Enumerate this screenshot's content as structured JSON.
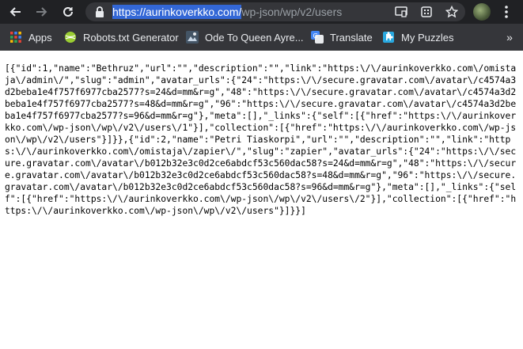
{
  "browser": {
    "url_host": "https://aurinkoverkko.com/",
    "url_path": "wp-json/wp/v2/users",
    "icons": {
      "back": "back-arrow-icon",
      "forward": "forward-arrow-icon",
      "reload": "reload-icon",
      "lock": "lock-icon",
      "cast": "cast-icon",
      "extensions": "extensions-icon",
      "bookmark": "star-icon",
      "menu": "kebab-menu-icon"
    }
  },
  "bookmarks": {
    "items": [
      {
        "label": "Apps",
        "icon": "apps-grid-icon"
      },
      {
        "label": "Robots.txt Generator",
        "icon": "robots-ball-icon"
      },
      {
        "label": "Ode To Queen Ayre...",
        "icon": "ode-image-icon"
      },
      {
        "label": "Translate",
        "icon": "google-translate-icon"
      },
      {
        "label": "My Puzzles",
        "icon": "puzzle-icon"
      }
    ],
    "more": "»"
  },
  "page": {
    "json_text": "[{\"id\":1,\"name\":\"Bethruz\",\"url\":\"\",\"description\":\"\",\"link\":\"https:\\/\\/aurinkoverkko.com\\/omistaja\\/admin\\/\",\"slug\":\"admin\",\"avatar_urls\":{\"24\":\"https:\\/\\/secure.gravatar.com\\/avatar\\/c4574a3d2beba1e4f757f6977cba2577?s=24&d=mm&r=g\",\"48\":\"https:\\/\\/secure.gravatar.com\\/avatar\\/c4574a3d2beba1e4f757f6977cba2577?s=48&d=mm&r=g\",\"96\":\"https:\\/\\/secure.gravatar.com\\/avatar\\/c4574a3d2beba1e4f757f6977cba2577?s=96&d=mm&r=g\"},\"meta\":[],\"_links\":{\"self\":[{\"href\":\"https:\\/\\/aurinkoverkko.com\\/wp-json\\/wp\\/v2\\/users\\/1\"}],\"collection\":[{\"href\":\"https:\\/\\/aurinkoverkko.com\\/wp-json\\/wp\\/v2\\/users\"}]}},{\"id\":2,\"name\":\"Petri Tiaskorpi\",\"url\":\"\",\"description\":\"\",\"link\":\"https:\\/\\/aurinkoverkko.com\\/omistaja\\/zapier\\/\",\"slug\":\"zapier\",\"avatar_urls\":{\"24\":\"https:\\/\\/secure.gravatar.com\\/avatar\\/b012b32e3c0d2ce6abdcf53c560dac58?s=24&d=mm&r=g\",\"48\":\"https:\\/\\/secure.gravatar.com\\/avatar\\/b012b32e3c0d2ce6abdcf53c560dac58?s=48&d=mm&r=g\",\"96\":\"https:\\/\\/secure.gravatar.com\\/avatar\\/b012b32e3c0d2ce6abdcf53c560dac58?s=96&d=mm&r=g\"},\"meta\":[],\"_links\":{\"self\":[{\"href\":\"https:\\/\\/aurinkoverkko.com\\/wp-json\\/wp\\/v2\\/users\\/2\"}],\"collection\":[{\"href\":\"https:\\/\\/aurinkoverkko.com\\/wp-json\\/wp\\/v2\\/users\"}]}}]"
  }
}
